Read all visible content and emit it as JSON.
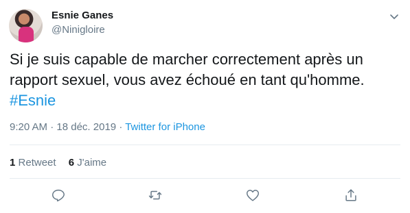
{
  "user": {
    "display_name": "Esnie Ganes",
    "handle": "@Ninigloire",
    "avatar_icon": "profile-photo"
  },
  "tweet": {
    "text": "Si je suis capable de marcher correctement après un rapport sexuel, vous avez échoué en tant qu'homme.",
    "hashtag": "#Esnie",
    "time": "9:20 AM",
    "date": "18 déc. 2019",
    "separator": "·",
    "source": "Twitter for iPhone"
  },
  "stats": {
    "retweets_count": "1",
    "retweets_label": "Retweet",
    "likes_count": "6",
    "likes_label": "J'aime"
  },
  "actions": {
    "reply_icon": "comment-icon",
    "retweet_icon": "retweet-icon",
    "like_icon": "heart-icon",
    "share_icon": "share-icon"
  },
  "colors": {
    "link": "#1b95e0",
    "secondary_text": "#657786",
    "primary_text": "#14171a",
    "divider": "#e6ecf0"
  }
}
